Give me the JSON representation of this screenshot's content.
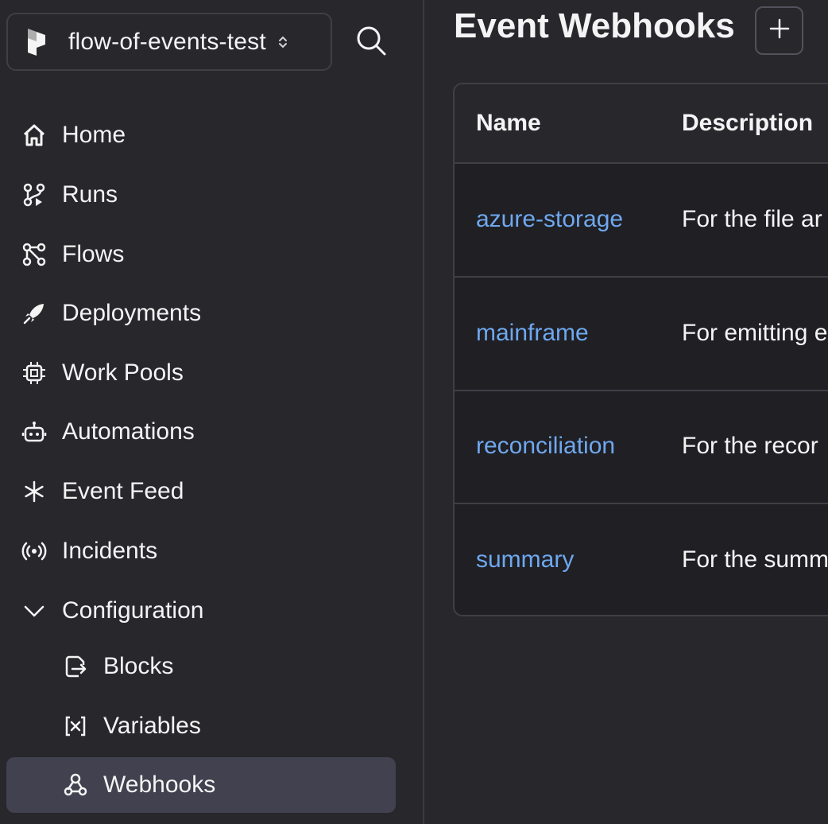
{
  "workspace": {
    "name": "flow-of-events-test"
  },
  "nav": {
    "home": "Home",
    "runs": "Runs",
    "flows": "Flows",
    "deployments": "Deployments",
    "work_pools": "Work Pools",
    "automations": "Automations",
    "event_feed": "Event Feed",
    "incidents": "Incidents",
    "configuration": "Configuration",
    "blocks": "Blocks",
    "variables": "Variables",
    "webhooks": "Webhooks"
  },
  "page": {
    "title": "Event Webhooks"
  },
  "table": {
    "columns": [
      "Name",
      "Description"
    ],
    "rows": [
      {
        "name": "azure-storage",
        "description": "For the file ar"
      },
      {
        "name": "mainframe",
        "description": "For emitting e"
      },
      {
        "name": "reconciliation",
        "description": "For the recor"
      },
      {
        "name": "summary",
        "description": "For the summ"
      }
    ]
  },
  "colors": {
    "background": "#27272c",
    "active_nav": "#41414f",
    "link": "#6fa8ee",
    "text": "#f4f4f5"
  },
  "icons": {
    "workspace_logo": "prefect-logo-icon",
    "search": "search-icon",
    "home": "home-icon",
    "runs": "runs-icon",
    "flows": "flows-icon",
    "deployments": "rocket-icon",
    "work_pools": "cpu-icon",
    "automations": "bot-icon",
    "event_feed": "asterisk-icon",
    "incidents": "radio-icon",
    "configuration": "chevron-down-icon",
    "blocks": "blocks-icon",
    "variables": "variable-icon",
    "webhooks": "webhook-icon",
    "add": "plus-icon"
  }
}
